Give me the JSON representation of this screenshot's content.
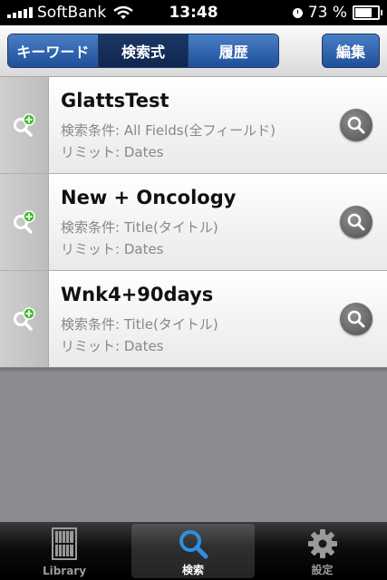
{
  "status_bar": {
    "carrier": "SoftBank",
    "time": "13:48",
    "battery": "73 %"
  },
  "toolbar": {
    "segments": [
      {
        "label": "キーワード",
        "active": false
      },
      {
        "label": "検索式",
        "active": true
      },
      {
        "label": "履歴",
        "active": false
      }
    ],
    "edit_label": "編集"
  },
  "searches": [
    {
      "title": "GlattsTest",
      "condition": "検索条件: All Fields(全フィールド)",
      "limit": "リミット: Dates"
    },
    {
      "title": "New + Oncology",
      "condition": "検索条件: Title(タイトル)",
      "limit": "リミット: Dates"
    },
    {
      "title": "Wnk4+90days",
      "condition": "検索条件: Title(タイトル)",
      "limit": "リミット: Dates"
    }
  ],
  "tabbar": {
    "tabs": [
      {
        "label": "Library",
        "icon": "bookshelf-icon",
        "active": false
      },
      {
        "label": "検索",
        "icon": "magnifier-icon",
        "active": true
      },
      {
        "label": "設定",
        "icon": "gear-icon",
        "active": false
      }
    ]
  },
  "colors": {
    "accent": "#1e4f9a",
    "active_tab_icon": "#2f8fe0",
    "add_badge": "#3cbf2a"
  }
}
